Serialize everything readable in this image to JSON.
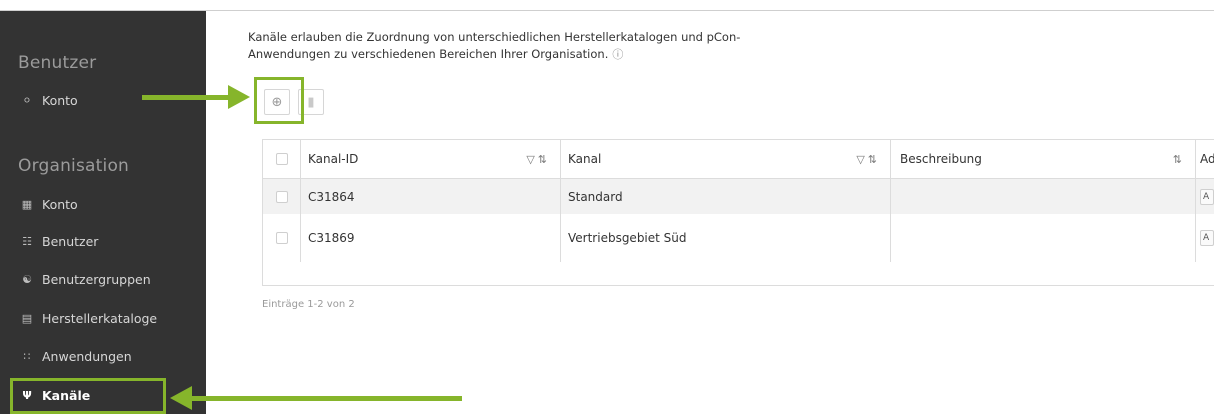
{
  "sidebar": {
    "user_section": {
      "title": "Benutzer",
      "items": [
        {
          "label": "Konto",
          "icon": "person-icon"
        }
      ]
    },
    "org_section": {
      "title": "Organisation",
      "items": [
        {
          "label": "Konto",
          "icon": "building-icon"
        },
        {
          "label": "Benutzer",
          "icon": "users-icon"
        },
        {
          "label": "Benutzergruppen",
          "icon": "user-groups-icon"
        },
        {
          "label": "Herstellerkataloge",
          "icon": "catalog-icon"
        },
        {
          "label": "Anwendungen",
          "icon": "apps-grid-icon"
        },
        {
          "label": "Kanäle",
          "icon": "channels-icon"
        }
      ]
    }
  },
  "main": {
    "intro_line1": "Kanäle erlauben die Zuordnung von unterschiedlichen Herstellerkatalogen und pCon-",
    "intro_line2": "Anwendungen zu verschiedenen Bereichen Ihrer Organisation.",
    "toolbar": {
      "add_icon": "add-circle-icon",
      "delete_icon": "trash-icon"
    },
    "table": {
      "columns": [
        "Kanal-ID",
        "Kanal",
        "Beschreibung",
        "Ad"
      ],
      "rows": [
        {
          "id": "C31864",
          "kanal": "Standard",
          "beschreibung": "",
          "action": "A"
        },
        {
          "id": "C31869",
          "kanal": "Vertriebsgebiet Süd",
          "beschreibung": "",
          "action": "A"
        }
      ]
    },
    "entries_text": "Einträge 1-2 von 2"
  },
  "colors": {
    "sidebar_bg": "#333333",
    "highlight": "#86b52b",
    "row_stripe": "#f2f2f2"
  }
}
